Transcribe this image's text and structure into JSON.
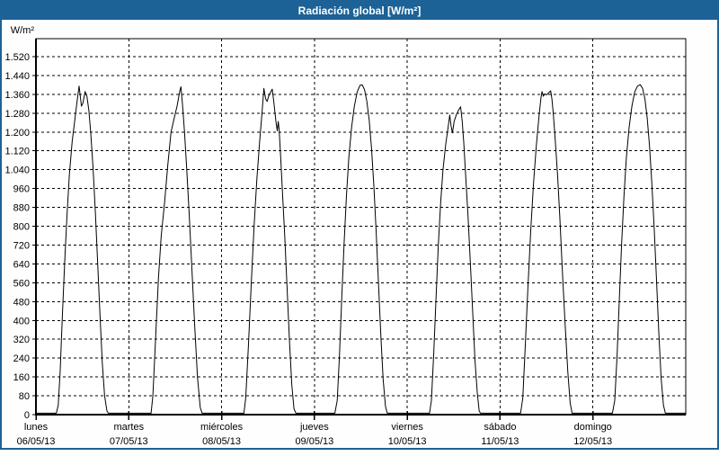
{
  "window": {
    "title": "Radiación global [W/m²]",
    "titlebar_color": "#1c6296",
    "border_color": "#1c6296",
    "background_color": "#fdfefd"
  },
  "chart_data": {
    "type": "line",
    "title": "Radiación global [W/m²]",
    "ylabel": "W/m²",
    "ylim": [
      0,
      1520
    ],
    "ytick_step": 80,
    "ytick_labels": [
      "0",
      "80",
      "160",
      "240",
      "320",
      "400",
      "480",
      "560",
      "640",
      "720",
      "800",
      "880",
      "960",
      "1.040",
      "1.120",
      "1.200",
      "1.280",
      "1.360",
      "1.440",
      "1.520"
    ],
    "grid": true,
    "legend_position": "none",
    "line_color": "#000000",
    "grid_color": "#000000",
    "axis_color": "#000000",
    "days": [
      {
        "name": "lunes",
        "date": "06/05/13",
        "peak": 1395,
        "points": [
          [
            0,
            0
          ],
          [
            0.22,
            0
          ],
          [
            0.24,
            40
          ],
          [
            0.26,
            180
          ],
          [
            0.285,
            420
          ],
          [
            0.31,
            650
          ],
          [
            0.335,
            850
          ],
          [
            0.36,
            1020
          ],
          [
            0.39,
            1160
          ],
          [
            0.415,
            1240
          ],
          [
            0.44,
            1320
          ],
          [
            0.465,
            1395
          ],
          [
            0.49,
            1310
          ],
          [
            0.505,
            1322
          ],
          [
            0.53,
            1372
          ],
          [
            0.55,
            1350
          ],
          [
            0.57,
            1290
          ],
          [
            0.59,
            1200
          ],
          [
            0.615,
            1050
          ],
          [
            0.64,
            860
          ],
          [
            0.665,
            640
          ],
          [
            0.69,
            420
          ],
          [
            0.715,
            220
          ],
          [
            0.74,
            80
          ],
          [
            0.765,
            15
          ],
          [
            0.78,
            0
          ],
          [
            1,
            0
          ]
        ]
      },
      {
        "name": "martes",
        "date": "07/05/13",
        "peak": 1392,
        "points": [
          [
            0,
            0
          ],
          [
            0.24,
            0
          ],
          [
            0.26,
            80
          ],
          [
            0.29,
            330
          ],
          [
            0.32,
            580
          ],
          [
            0.35,
            760
          ],
          [
            0.385,
            900
          ],
          [
            0.42,
            1060
          ],
          [
            0.455,
            1200
          ],
          [
            0.49,
            1260
          ],
          [
            0.52,
            1310
          ],
          [
            0.55,
            1375
          ],
          [
            0.562,
            1392
          ],
          [
            0.578,
            1320
          ],
          [
            0.6,
            1200
          ],
          [
            0.625,
            1040
          ],
          [
            0.65,
            860
          ],
          [
            0.68,
            620
          ],
          [
            0.71,
            380
          ],
          [
            0.74,
            160
          ],
          [
            0.77,
            30
          ],
          [
            0.79,
            0
          ],
          [
            1,
            0
          ]
        ]
      },
      {
        "name": "miércoles",
        "date": "08/05/13",
        "peak": 1385,
        "points": [
          [
            0,
            0
          ],
          [
            0.24,
            0
          ],
          [
            0.26,
            70
          ],
          [
            0.29,
            300
          ],
          [
            0.32,
            560
          ],
          [
            0.35,
            800
          ],
          [
            0.38,
            1000
          ],
          [
            0.41,
            1160
          ],
          [
            0.435,
            1280
          ],
          [
            0.455,
            1385
          ],
          [
            0.475,
            1340
          ],
          [
            0.49,
            1330
          ],
          [
            0.51,
            1355
          ],
          [
            0.545,
            1382
          ],
          [
            0.565,
            1320
          ],
          [
            0.585,
            1245
          ],
          [
            0.6,
            1205
          ],
          [
            0.61,
            1245
          ],
          [
            0.62,
            1210
          ],
          [
            0.635,
            1100
          ],
          [
            0.655,
            950
          ],
          [
            0.68,
            760
          ],
          [
            0.705,
            540
          ],
          [
            0.73,
            320
          ],
          [
            0.755,
            130
          ],
          [
            0.78,
            25
          ],
          [
            0.8,
            0
          ],
          [
            1,
            0
          ]
        ]
      },
      {
        "name": "jueves",
        "date": "09/05/13",
        "peak": 1400,
        "points": [
          [
            0,
            0
          ],
          [
            0.22,
            0
          ],
          [
            0.245,
            60
          ],
          [
            0.27,
            250
          ],
          [
            0.295,
            500
          ],
          [
            0.32,
            730
          ],
          [
            0.345,
            930
          ],
          [
            0.37,
            1090
          ],
          [
            0.4,
            1220
          ],
          [
            0.43,
            1310
          ],
          [
            0.46,
            1370
          ],
          [
            0.49,
            1398
          ],
          [
            0.515,
            1400
          ],
          [
            0.54,
            1380
          ],
          [
            0.565,
            1330
          ],
          [
            0.59,
            1250
          ],
          [
            0.615,
            1130
          ],
          [
            0.64,
            970
          ],
          [
            0.665,
            780
          ],
          [
            0.69,
            560
          ],
          [
            0.715,
            340
          ],
          [
            0.74,
            150
          ],
          [
            0.765,
            35
          ],
          [
            0.785,
            0
          ],
          [
            1,
            0
          ]
        ]
      },
      {
        "name": "viernes",
        "date": "10/05/13",
        "peak": 1307,
        "points": [
          [
            0,
            0
          ],
          [
            0.24,
            0
          ],
          [
            0.26,
            60
          ],
          [
            0.285,
            260
          ],
          [
            0.31,
            500
          ],
          [
            0.335,
            720
          ],
          [
            0.36,
            900
          ],
          [
            0.385,
            1040
          ],
          [
            0.415,
            1150
          ],
          [
            0.44,
            1220
          ],
          [
            0.458,
            1272
          ],
          [
            0.472,
            1225
          ],
          [
            0.487,
            1196
          ],
          [
            0.505,
            1245
          ],
          [
            0.53,
            1275
          ],
          [
            0.555,
            1295
          ],
          [
            0.575,
            1307
          ],
          [
            0.592,
            1245
          ],
          [
            0.61,
            1150
          ],
          [
            0.63,
            1010
          ],
          [
            0.655,
            840
          ],
          [
            0.68,
            640
          ],
          [
            0.705,
            430
          ],
          [
            0.73,
            230
          ],
          [
            0.755,
            90
          ],
          [
            0.775,
            15
          ],
          [
            0.79,
            0
          ],
          [
            1,
            0
          ]
        ]
      },
      {
        "name": "sábado",
        "date": "11/05/13",
        "peak": 1375,
        "points": [
          [
            0,
            0
          ],
          [
            0.22,
            0
          ],
          [
            0.245,
            70
          ],
          [
            0.27,
            280
          ],
          [
            0.3,
            540
          ],
          [
            0.33,
            780
          ],
          [
            0.36,
            980
          ],
          [
            0.39,
            1140
          ],
          [
            0.42,
            1270
          ],
          [
            0.44,
            1345
          ],
          [
            0.452,
            1372
          ],
          [
            0.465,
            1352
          ],
          [
            0.48,
            1362
          ],
          [
            0.5,
            1358
          ],
          [
            0.52,
            1365
          ],
          [
            0.545,
            1375
          ],
          [
            0.558,
            1340
          ],
          [
            0.575,
            1270
          ],
          [
            0.595,
            1160
          ],
          [
            0.62,
            1010
          ],
          [
            0.645,
            830
          ],
          [
            0.67,
            620
          ],
          [
            0.7,
            390
          ],
          [
            0.73,
            180
          ],
          [
            0.755,
            50
          ],
          [
            0.775,
            0
          ],
          [
            1,
            0
          ]
        ]
      },
      {
        "name": "domingo",
        "date": "12/05/13",
        "peak": 1401,
        "points": [
          [
            0,
            0
          ],
          [
            0.21,
            0
          ],
          [
            0.235,
            60
          ],
          [
            0.26,
            250
          ],
          [
            0.285,
            500
          ],
          [
            0.31,
            730
          ],
          [
            0.335,
            930
          ],
          [
            0.36,
            1090
          ],
          [
            0.39,
            1220
          ],
          [
            0.42,
            1310
          ],
          [
            0.45,
            1370
          ],
          [
            0.48,
            1395
          ],
          [
            0.51,
            1401
          ],
          [
            0.535,
            1385
          ],
          [
            0.56,
            1340
          ],
          [
            0.585,
            1260
          ],
          [
            0.61,
            1140
          ],
          [
            0.635,
            980
          ],
          [
            0.66,
            790
          ],
          [
            0.685,
            570
          ],
          [
            0.71,
            350
          ],
          [
            0.735,
            155
          ],
          [
            0.76,
            40
          ],
          [
            0.78,
            0
          ],
          [
            1,
            0
          ]
        ]
      }
    ]
  }
}
